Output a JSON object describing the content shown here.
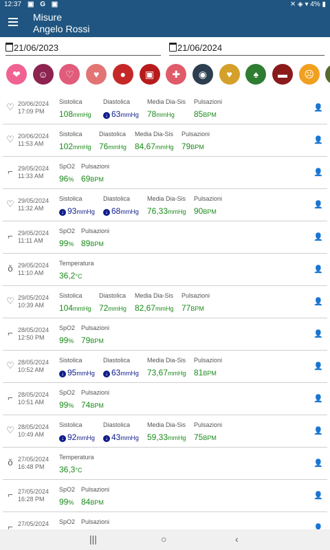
{
  "status": {
    "time": "12:37",
    "indicators": "▣ G ▣",
    "right": "✕ ◈ ▾ 4% ▮"
  },
  "appbar": {
    "title": "Misure",
    "subtitle": "Angelo Rossi"
  },
  "filters": {
    "from": "21/06/2023",
    "to": "21/06/2024"
  },
  "categories": [
    {
      "name": "heart-hands-icon",
      "color": "#f06292",
      "glyph": "❤"
    },
    {
      "name": "body-icon",
      "color": "#8e2350",
      "glyph": "☺"
    },
    {
      "name": "heart-pulse-icon",
      "color": "#e15b7a",
      "glyph": "♡"
    },
    {
      "name": "heart-monitor-icon",
      "color": "#e37474",
      "glyph": "♥"
    },
    {
      "name": "blood-drop-icon",
      "color": "#c62828",
      "glyph": "●"
    },
    {
      "name": "glucometer-icon",
      "color": "#b71c1c",
      "glyph": "▣"
    },
    {
      "name": "syringe-icon",
      "color": "#e05b6a",
      "glyph": "✚"
    },
    {
      "name": "scale-icon",
      "color": "#2c3e50",
      "glyph": "◉"
    },
    {
      "name": "heart-pill-icon",
      "color": "#d4a02a",
      "glyph": "♥"
    },
    {
      "name": "lungs-icon",
      "color": "#2e7d32",
      "glyph": "♠"
    },
    {
      "name": "thermometer-icon",
      "color": "#8b1a1a",
      "glyph": "▬"
    },
    {
      "name": "cough-icon",
      "color": "#f0a020",
      "glyph": "☹"
    },
    {
      "name": "more-icon",
      "color": "#556b2f",
      "glyph": "•"
    }
  ],
  "colors": {
    "accent": "#1f5580",
    "value_green": "#1a8a1a",
    "value_blue": "#0f1d8a"
  },
  "measurements": [
    {
      "type": "pressure",
      "date": "20/06/2024",
      "time": "17:09 PM",
      "cols": [
        {
          "label": "Sistolica",
          "value": "108",
          "unit": "mmHg"
        },
        {
          "label": "Diastolica",
          "value": "63",
          "unit": "mmHg",
          "low": true
        },
        {
          "label": "Media Dia-Sis",
          "value": "78",
          "unit": "mmHg"
        },
        {
          "label": "Pulsazioni",
          "value": "85",
          "unit": "BPM"
        }
      ]
    },
    {
      "type": "pressure",
      "date": "20/06/2024",
      "time": "11:53 AM",
      "cols": [
        {
          "label": "Sistolica",
          "value": "102",
          "unit": "mmHg"
        },
        {
          "label": "Diastolica",
          "value": "76",
          "unit": "mmHg"
        },
        {
          "label": "Media Dia-Sis",
          "value": "84,67",
          "unit": "mmHg"
        },
        {
          "label": "Pulsazioni",
          "value": "79",
          "unit": "BPM"
        }
      ]
    },
    {
      "type": "oximeter",
      "date": "29/05/2024",
      "time": "11:33 AM",
      "cols": [
        {
          "label": "SpO2",
          "value": "96",
          "unit": "%"
        },
        {
          "label": "Pulsazioni",
          "value": "69",
          "unit": "BPM"
        }
      ]
    },
    {
      "type": "pressure",
      "date": "29/05/2024",
      "time": "11:32 AM",
      "cols": [
        {
          "label": "Sistolica",
          "value": "93",
          "unit": "mmHg",
          "low": true
        },
        {
          "label": "Diastolica",
          "value": "68",
          "unit": "mmHg",
          "low": true
        },
        {
          "label": "Media Dia-Sis",
          "value": "76,33",
          "unit": "mmHg"
        },
        {
          "label": "Pulsazioni",
          "value": "90",
          "unit": "BPM"
        }
      ]
    },
    {
      "type": "oximeter",
      "date": "29/05/2024",
      "time": "11:11 AM",
      "cols": [
        {
          "label": "SpO2",
          "value": "99",
          "unit": "%"
        },
        {
          "label": "Pulsazioni",
          "value": "89",
          "unit": "BPM"
        }
      ]
    },
    {
      "type": "temperature",
      "date": "29/05/2024",
      "time": "11:10 AM",
      "cols": [
        {
          "label": "Temperatura",
          "value": "36,2",
          "unit": "°C"
        }
      ]
    },
    {
      "type": "pressure",
      "date": "29/05/2024",
      "time": "10:39 AM",
      "cols": [
        {
          "label": "Sistolica",
          "value": "104",
          "unit": "mmHg"
        },
        {
          "label": "Diastolica",
          "value": "72",
          "unit": "mmHg"
        },
        {
          "label": "Media Dia-Sis",
          "value": "82,67",
          "unit": "mmHg"
        },
        {
          "label": "Pulsazioni",
          "value": "77",
          "unit": "BPM"
        }
      ]
    },
    {
      "type": "oximeter",
      "date": "28/05/2024",
      "time": "12:50 PM",
      "cols": [
        {
          "label": "SpO2",
          "value": "99",
          "unit": "%"
        },
        {
          "label": "Pulsazioni",
          "value": "79",
          "unit": "BPM"
        }
      ]
    },
    {
      "type": "pressure",
      "date": "28/05/2024",
      "time": "10:52 AM",
      "cols": [
        {
          "label": "Sistolica",
          "value": "95",
          "unit": "mmHg",
          "low": true
        },
        {
          "label": "Diastolica",
          "value": "63",
          "unit": "mmHg",
          "low": true
        },
        {
          "label": "Media Dia-Sis",
          "value": "73,67",
          "unit": "mmHg"
        },
        {
          "label": "Pulsazioni",
          "value": "81",
          "unit": "BPM"
        }
      ]
    },
    {
      "type": "oximeter",
      "date": "28/05/2024",
      "time": "10:51 AM",
      "cols": [
        {
          "label": "SpO2",
          "value": "99",
          "unit": "%"
        },
        {
          "label": "Pulsazioni",
          "value": "74",
          "unit": "BPM"
        }
      ]
    },
    {
      "type": "pressure",
      "date": "28/05/2024",
      "time": "10:49 AM",
      "cols": [
        {
          "label": "Sistolica",
          "value": "92",
          "unit": "mmHg",
          "low": true
        },
        {
          "label": "Diastolica",
          "value": "43",
          "unit": "mmHg",
          "low": true
        },
        {
          "label": "Media Dia-Sis",
          "value": "59,33",
          "unit": "mmHg"
        },
        {
          "label": "Pulsazioni",
          "value": "75",
          "unit": "BPM"
        }
      ]
    },
    {
      "type": "temperature",
      "date": "27/05/2024",
      "time": "16:48 PM",
      "cols": [
        {
          "label": "Temperatura",
          "value": "36,3",
          "unit": "°C"
        }
      ]
    },
    {
      "type": "oximeter",
      "date": "27/05/2024",
      "time": "16:28 PM",
      "cols": [
        {
          "label": "SpO2",
          "value": "99",
          "unit": "%"
        },
        {
          "label": "Pulsazioni",
          "value": "84",
          "unit": "BPM"
        }
      ]
    },
    {
      "type": "oximeter",
      "date": "27/05/2024",
      "time": "",
      "cols": [
        {
          "label": "SpO2",
          "value": "",
          "unit": ""
        },
        {
          "label": "Pulsazioni",
          "value": "",
          "unit": ""
        }
      ]
    }
  ],
  "navbar": {
    "recents": "|||",
    "home": "○",
    "back": "‹"
  }
}
